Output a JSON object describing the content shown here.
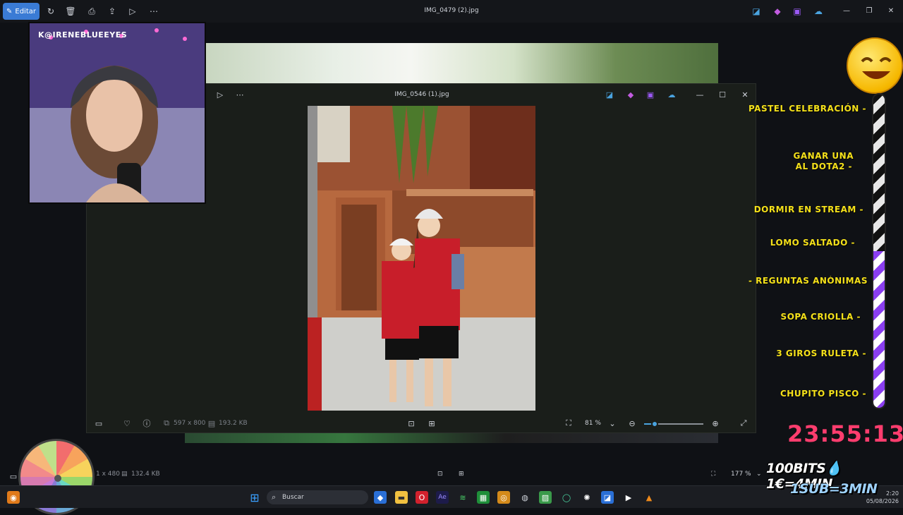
{
  "outer_window": {
    "edit_label": "Editar",
    "title": "IMG_0479 (2).jpg",
    "status_dims": "1 x 480",
    "status_size": "132.4 KB",
    "zoom": "177 %"
  },
  "inner_window": {
    "title": "IMG_0546 (1).jpg",
    "dims": "597 x 800",
    "size": "193.2 KB",
    "zoom": "81 %"
  },
  "webcam": {
    "handle": "K@IRENEBLUEEYES"
  },
  "stream_list": {
    "items": [
      "PASTEL CELEBRACIÓN -",
      "GANAR UNA",
      "AL DOTA2 -",
      "DORMIR EN STREAM -",
      "LOMO SALTADO -",
      "REGUNTAS ANÓNIMAS -",
      "SOPA CRIOLLA -",
      "3 GIROS RULETA -",
      "CHUPITO PISCO -"
    ],
    "progress": 0.5
  },
  "timer": "23:55:13",
  "promo": {
    "line1": "100BITS💧1€=4MIN",
    "line2": "1SUB=3MIN"
  },
  "taskbar": {
    "search_placeholder": "Buscar",
    "time": "2:20",
    "date": "05/08/2026"
  },
  "colors": {
    "accent": "#3a7bd5",
    "list_text": "#f5e11a",
    "timer": "#ff3d6e"
  }
}
